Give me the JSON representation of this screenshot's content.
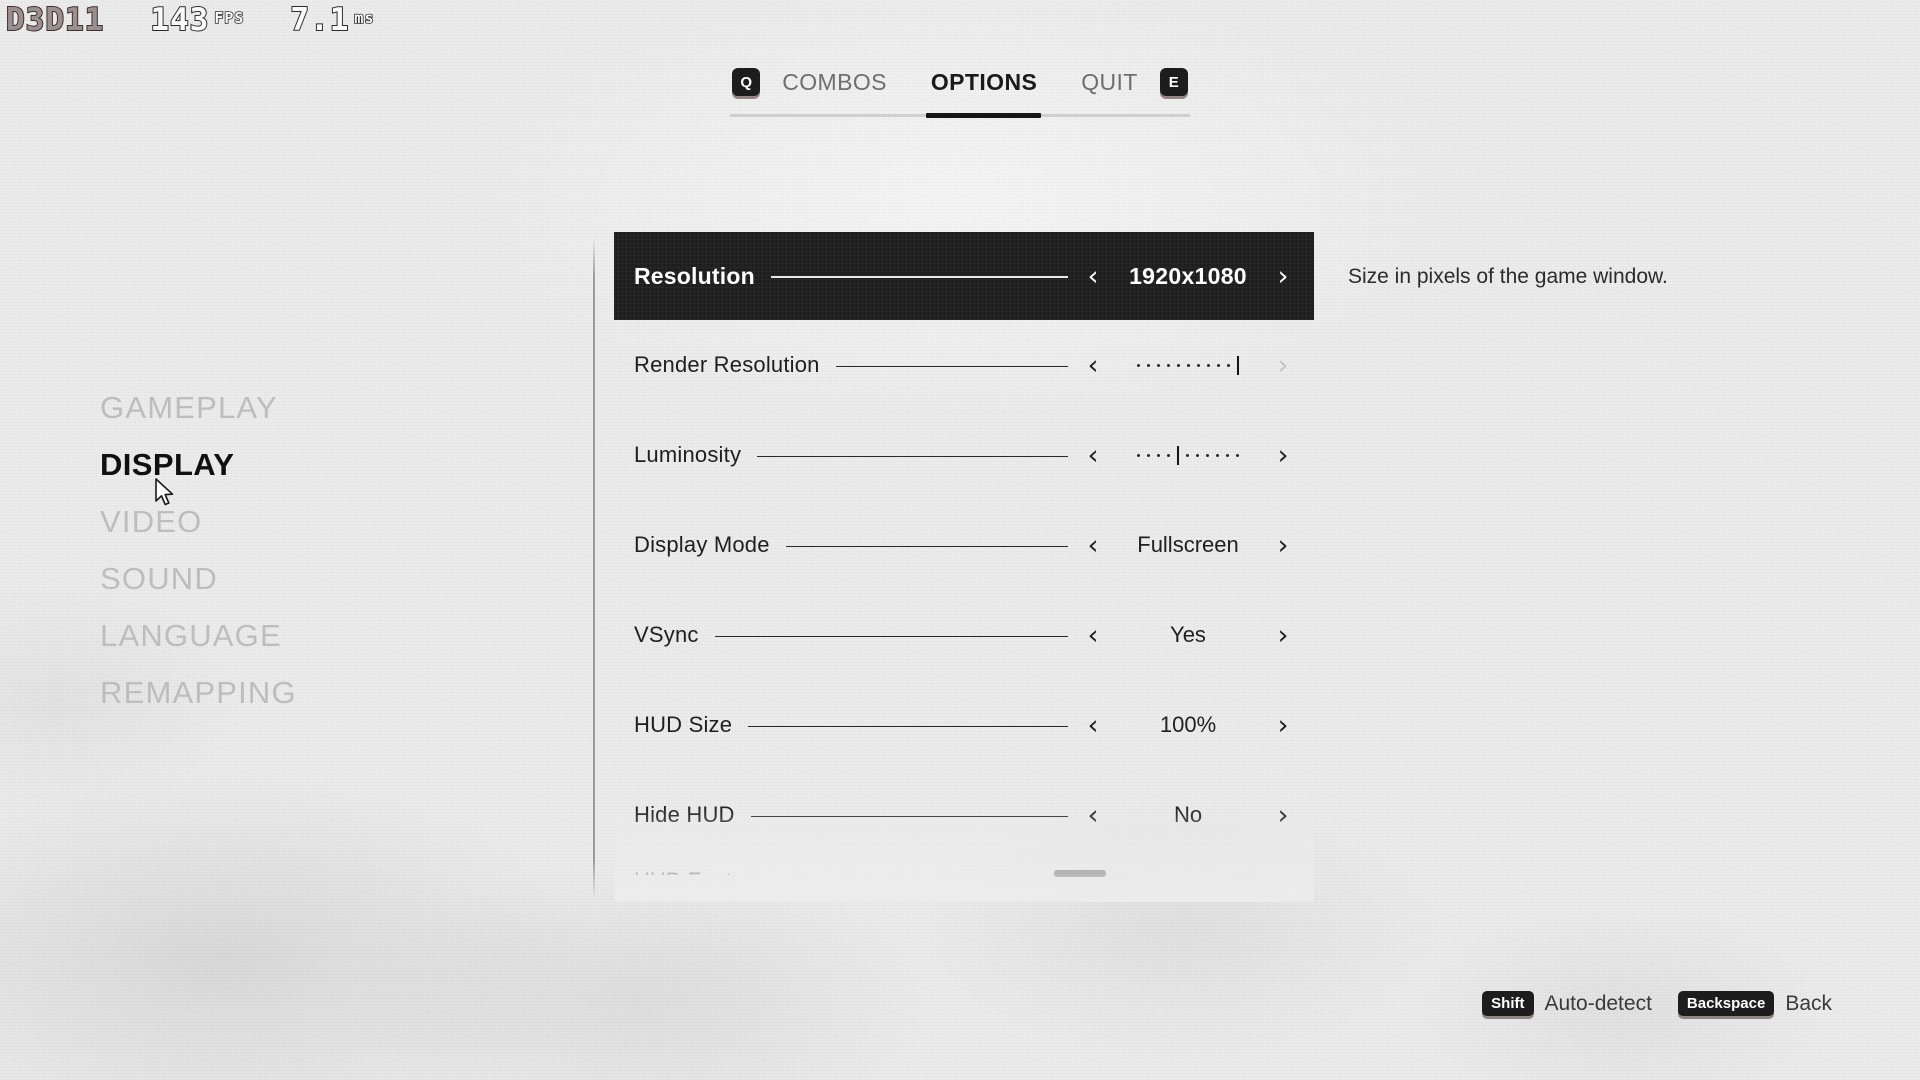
{
  "perf_hud": {
    "api": "D3D11",
    "fps_value": "143",
    "fps_unit": "FPS",
    "frametime_value": "7.1",
    "frametime_unit": "ms"
  },
  "topnav": {
    "left_key": "Q",
    "right_key": "E",
    "tabs": [
      {
        "label": "COMBOS",
        "active": false
      },
      {
        "label": "OPTIONS",
        "active": true
      },
      {
        "label": "QUIT",
        "active": false
      }
    ]
  },
  "sidebar": {
    "items": [
      {
        "label": "GAMEPLAY",
        "active": false
      },
      {
        "label": "DISPLAY",
        "active": true
      },
      {
        "label": "VIDEO",
        "active": false
      },
      {
        "label": "SOUND",
        "active": false
      },
      {
        "label": "LANGUAGE",
        "active": false
      },
      {
        "label": "REMAPPING",
        "active": false
      }
    ]
  },
  "options": {
    "rows": [
      {
        "label": "Resolution",
        "type": "value",
        "value": "1920x1080",
        "highlighted": true,
        "left_arrow": "‹",
        "right_arrow": "›",
        "left_enabled": true,
        "right_enabled": true
      },
      {
        "label": "Render Resolution",
        "type": "slider",
        "highlighted": false,
        "left_arrow": "‹",
        "right_arrow": "›",
        "left_enabled": true,
        "right_enabled": false,
        "slider": {
          "steps": 10,
          "position": 10
        }
      },
      {
        "label": "Luminosity",
        "type": "slider",
        "highlighted": false,
        "left_arrow": "‹",
        "right_arrow": "›",
        "left_enabled": true,
        "right_enabled": true,
        "slider": {
          "steps": 10,
          "position": 4
        }
      },
      {
        "label": "Display Mode",
        "type": "value",
        "value": "Fullscreen",
        "highlighted": false,
        "left_arrow": "‹",
        "right_arrow": "›",
        "left_enabled": true,
        "right_enabled": true
      },
      {
        "label": "VSync",
        "type": "value",
        "value": "Yes",
        "highlighted": false,
        "left_arrow": "‹",
        "right_arrow": "›",
        "left_enabled": true,
        "right_enabled": true
      },
      {
        "label": "HUD Size",
        "type": "value",
        "value": "100%",
        "highlighted": false,
        "left_arrow": "‹",
        "right_arrow": "›",
        "left_enabled": true,
        "right_enabled": true
      },
      {
        "label": "Hide HUD",
        "type": "value",
        "value": "No",
        "highlighted": false,
        "left_arrow": "‹",
        "right_arrow": "›",
        "left_enabled": true,
        "right_enabled": true
      }
    ],
    "clipped_row_label": "HUD Font"
  },
  "description": {
    "text": "Size in pixels of the game window."
  },
  "hints": [
    {
      "key": "Shift",
      "label": "Auto-detect"
    },
    {
      "key": "Backspace",
      "label": "Back"
    }
  ],
  "colors": {
    "background": "#ececec",
    "highlight_row": "#1e1e1e",
    "text_primary": "#1f1f1f",
    "text_inactive": "#bdbdbd",
    "keycap": "#1d1d1d"
  }
}
